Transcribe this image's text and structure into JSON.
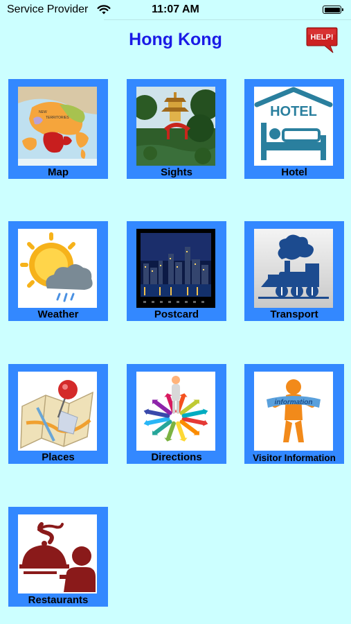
{
  "status_bar": {
    "carrier": "Service Provider",
    "time": "11:07 AM",
    "wifi_icon": "wifi-icon",
    "battery_icon": "battery-icon"
  },
  "header": {
    "title": "Hong Kong",
    "help_label": "HELP!",
    "help_icon": "help-speech-bubble-icon"
  },
  "tiles": [
    {
      "label": "Map",
      "icon": "map-icon"
    },
    {
      "label": "Sights",
      "icon": "pagoda-photo-icon"
    },
    {
      "label": "Hotel",
      "icon": "hotel-bed-icon",
      "icon_text": "HOTEL"
    },
    {
      "label": "Weather",
      "icon": "weather-icon"
    },
    {
      "label": "Postcard",
      "icon": "city-skyline-photo-icon"
    },
    {
      "label": "Transport",
      "icon": "train-icon"
    },
    {
      "label": "Places",
      "icon": "pinned-map-icon"
    },
    {
      "label": "Directions",
      "icon": "directions-arrows-icon"
    },
    {
      "label": "Visitor Information",
      "icon": "information-person-icon",
      "icon_text": "information"
    },
    {
      "label": "Restaurants",
      "icon": "waiter-cloche-icon"
    }
  ],
  "colors": {
    "background": "#ccffff",
    "tile_border": "#3388ff",
    "title": "#1a1ae6",
    "help_badge": "#cc2222"
  }
}
